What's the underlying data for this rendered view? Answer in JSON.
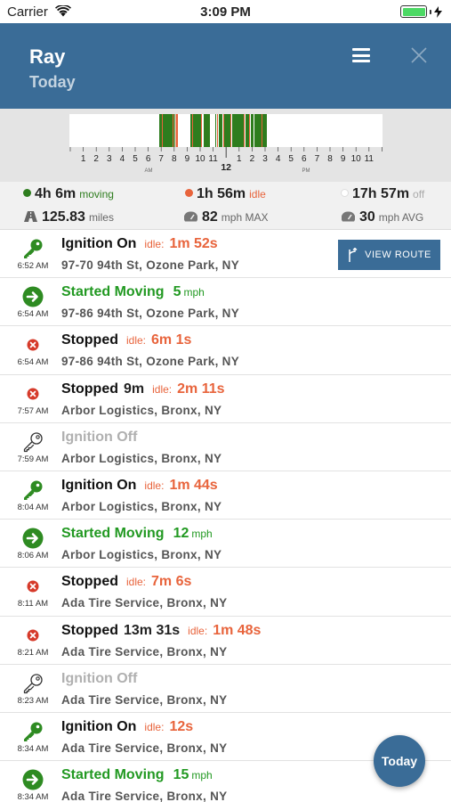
{
  "status_bar": {
    "carrier": "Carrier",
    "time": "3:09 PM"
  },
  "header": {
    "name": "Ray",
    "subtitle": "Today",
    "menu_icon": "hamburger-menu-icon",
    "close_icon": "close-icon"
  },
  "timeline": {
    "hour_labels": [
      "1",
      "2",
      "3",
      "4",
      "5",
      "6",
      "7",
      "8",
      "9",
      "10",
      "11",
      "12",
      "1",
      "2",
      "3",
      "4",
      "5",
      "6",
      "7",
      "8",
      "9",
      "10",
      "11"
    ],
    "am_label": "AM",
    "pm_label": "PM",
    "noon_label": "12",
    "colors": {
      "moving": "#2e7d1e",
      "idle": "#e8643c",
      "off": "#ffffff"
    }
  },
  "stats": {
    "moving": {
      "value": "4h 6m",
      "label": "moving",
      "color": "#2e7d1e"
    },
    "idle": {
      "value": "1h 56m",
      "label": "idle",
      "color": "#e8643c"
    },
    "off": {
      "value": "17h 57m",
      "label": "off",
      "color": "#ffffff"
    },
    "distance": {
      "value": "125.83",
      "unit": "miles"
    },
    "max_speed": {
      "value": "82",
      "unit": "mph MAX"
    },
    "avg_speed": {
      "value": "30",
      "unit": "mph AVG"
    }
  },
  "view_route_label": "VIEW ROUTE",
  "events": [
    {
      "type": "ignition-on",
      "icon": "key-green-icon",
      "time": "6:52 AM",
      "title": "Ignition On",
      "title_style": "black",
      "idle_label": "idle:",
      "idle": "1m 52s",
      "address": "97-70 94th St, Ozone Park, NY"
    },
    {
      "type": "started-moving",
      "icon": "arrow-right-circle-icon",
      "time": "6:54 AM",
      "title": "Started Moving",
      "title_style": "green",
      "speed": "5",
      "speed_unit": "mph",
      "address": "97-86 94th St, Ozone Park, NY"
    },
    {
      "type": "stopped",
      "icon": "stop-x-icon",
      "time": "6:54 AM",
      "title": "Stopped",
      "title_style": "black",
      "idle_label": "idle:",
      "idle": "6m 1s",
      "address": "97-86 94th St, Ozone Park, NY"
    },
    {
      "type": "stopped",
      "icon": "stop-x-icon",
      "time": "7:57 AM",
      "title": "Stopped",
      "title_style": "black",
      "duration": "9m",
      "idle_label": "idle:",
      "idle": "2m 11s",
      "address": "Arbor Logistics, Bronx, NY"
    },
    {
      "type": "ignition-off",
      "icon": "key-outline-icon",
      "time": "7:59 AM",
      "title": "Ignition Off",
      "title_style": "gray",
      "address": "Arbor Logistics, Bronx, NY"
    },
    {
      "type": "ignition-on",
      "icon": "key-green-icon",
      "time": "8:04 AM",
      "title": "Ignition On",
      "title_style": "black",
      "idle_label": "idle:",
      "idle": "1m 44s",
      "address": "Arbor Logistics, Bronx, NY"
    },
    {
      "type": "started-moving",
      "icon": "arrow-right-circle-icon",
      "time": "8:06 AM",
      "title": "Started Moving",
      "title_style": "green",
      "speed": "12",
      "speed_unit": "mph",
      "address": "Arbor Logistics, Bronx, NY"
    },
    {
      "type": "stopped",
      "icon": "stop-x-icon",
      "time": "8:11 AM",
      "title": "Stopped",
      "title_style": "black",
      "idle_label": "idle:",
      "idle": "7m 6s",
      "address": "Ada Tire Service, Bronx, NY"
    },
    {
      "type": "stopped",
      "icon": "stop-x-icon",
      "time": "8:21 AM",
      "title": "Stopped",
      "title_style": "black",
      "duration": "13m 31s",
      "idle_label": "idle:",
      "idle": "1m 48s",
      "address": "Ada Tire Service, Bronx, NY"
    },
    {
      "type": "ignition-off",
      "icon": "key-outline-icon",
      "time": "8:23 AM",
      "title": "Ignition Off",
      "title_style": "gray",
      "address": "Ada Tire Service, Bronx, NY"
    },
    {
      "type": "ignition-on",
      "icon": "key-green-icon",
      "time": "8:34 AM",
      "title": "Ignition On",
      "title_style": "black",
      "idle_label": "idle:",
      "idle": "12s",
      "address": "Ada Tire Service, Bronx, NY"
    },
    {
      "type": "started-moving",
      "icon": "arrow-right-circle-icon",
      "time": "8:34 AM",
      "title": "Started Moving",
      "title_style": "green",
      "speed": "15",
      "speed_unit": "mph",
      "address": "Ada Tire Service, Bronx, NY"
    }
  ],
  "fab_label": "Today"
}
